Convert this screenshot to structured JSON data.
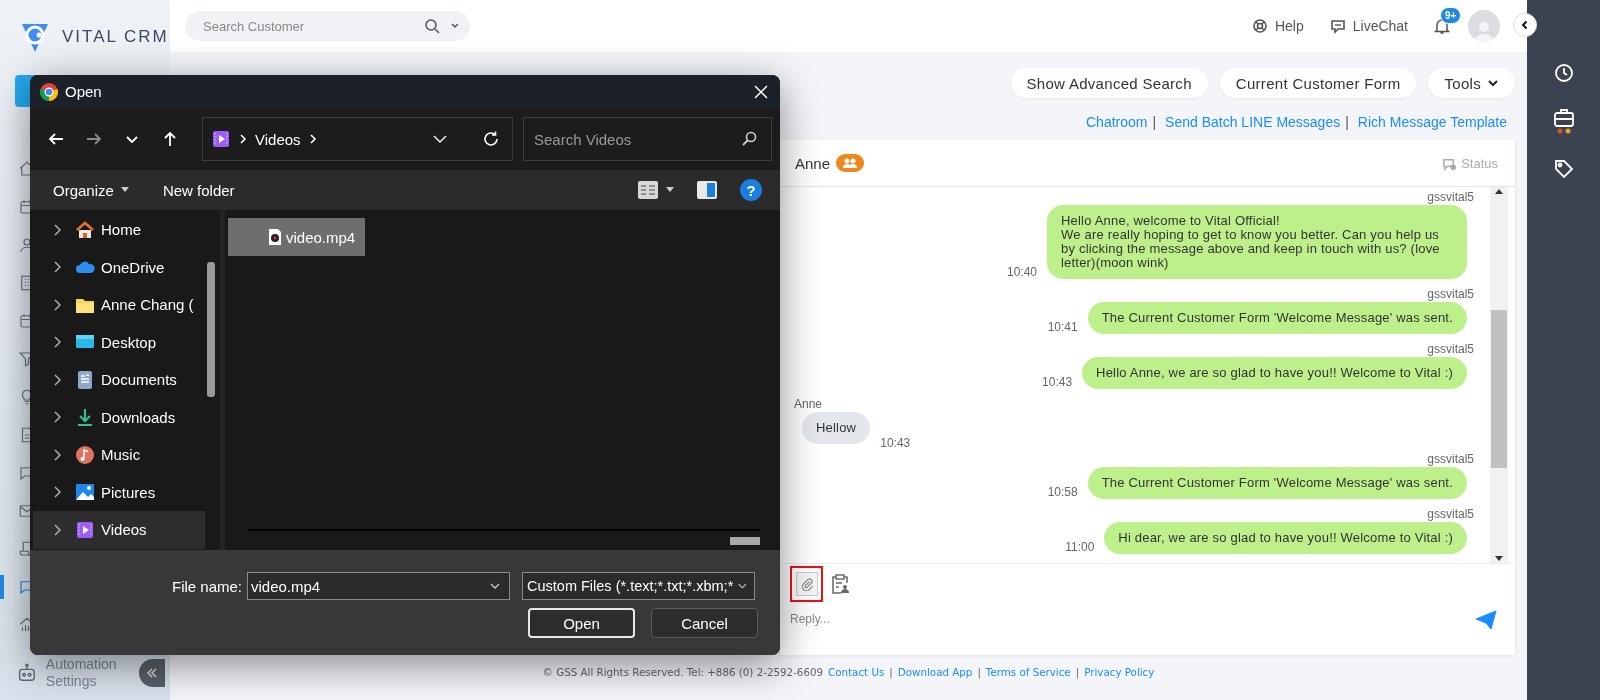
{
  "sidebar": {
    "logo": "VITAL CRM",
    "items": [
      {
        "kind": "home",
        "selected": false
      },
      {
        "kind": "calendar",
        "selected": false
      },
      {
        "kind": "user",
        "selected": false
      },
      {
        "kind": "building",
        "selected": false
      },
      {
        "kind": "calendar",
        "selected": false
      },
      {
        "kind": "filter",
        "selected": false
      },
      {
        "kind": "lightbulb",
        "selected": false
      },
      {
        "kind": "document",
        "selected": false
      },
      {
        "kind": "chat",
        "selected": false
      },
      {
        "kind": "mail",
        "selected": false
      },
      {
        "kind": "scroll",
        "selected": false
      },
      {
        "kind": "chat",
        "selected": true
      },
      {
        "kind": "chart",
        "selected": false
      }
    ],
    "bottom_item": {
      "label": "Automation Settings"
    }
  },
  "topbar": {
    "search": {
      "placeholder": "Search Customer"
    },
    "links": [
      {
        "kind": "help",
        "label": "Help"
      },
      {
        "kind": "livechat",
        "label": "LiveChat"
      }
    ],
    "notification_count": "9+"
  },
  "actions": [
    {
      "label": "Show Advanced Search",
      "menu": false
    },
    {
      "label": "Current Customer Form",
      "menu": false
    },
    {
      "label": "Tools",
      "menu": true
    }
  ],
  "link_bar": [
    {
      "kind": "link",
      "text": "Chatroom"
    },
    {
      "kind": "separator",
      "text": "|"
    },
    {
      "kind": "link",
      "text": "Send Batch LINE Messages"
    },
    {
      "kind": "separator",
      "text": "|"
    },
    {
      "kind": "link",
      "text": "Rich Message Template"
    }
  ],
  "chat": {
    "contact": "Anne",
    "status": "Status",
    "messages": [
      {
        "kind": "outgoing",
        "sender": "gssvital5",
        "text": "Hello Anne, welcome to Vital Official!\nWe are really hoping to get to know you better. Can you help us by clicking the message above and keep in touch with us? (love letter)(moon wink)",
        "time": "10:40"
      },
      {
        "kind": "outgoing",
        "sender": "gssvital5",
        "text": "The Current Customer Form 'Welcome Message' was sent.",
        "time": "10:41"
      },
      {
        "kind": "outgoing",
        "sender": "gssvital5",
        "text": "Hello Anne, we are so glad to have you!! Welcome to Vital :)",
        "time": "10:43"
      },
      {
        "kind": "incoming",
        "sender": "Anne",
        "text": "Hellow",
        "time": "10:43"
      },
      {
        "kind": "outgoing",
        "sender": "gssvital5",
        "text": "The Current Customer Form 'Welcome Message' was sent.",
        "time": "10:58"
      },
      {
        "kind": "outgoing",
        "sender": "gssvital5",
        "text": "Hi dear, we are so glad to have you!! Welcome to Vital :)",
        "time": "11:00"
      }
    ],
    "composer": {
      "placeholder": "Reply...",
      "attach_highlighted": true
    }
  },
  "footer": [
    {
      "kind": "text",
      "text": "© GSS All Rights Reserved. Tel: +886 (0) 2-2592-6609"
    },
    {
      "kind": "link",
      "text": "Contact Us"
    },
    {
      "kind": "separator",
      "text": "|"
    },
    {
      "kind": "link",
      "text": "Download App"
    },
    {
      "kind": "separator",
      "text": "|"
    },
    {
      "kind": "link",
      "text": "Terms of Service"
    },
    {
      "kind": "separator",
      "text": "|"
    },
    {
      "kind": "link",
      "text": "Privacy Policy"
    }
  ],
  "dialog": {
    "title": "Open",
    "address": [
      "Videos"
    ],
    "search": {
      "placeholder": "Search Videos"
    },
    "commands": [
      {
        "label": "Organize",
        "menu": true
      },
      {
        "label": "New folder",
        "menu": false
      }
    ],
    "help": "?",
    "nav_items": [
      {
        "kind": "home",
        "label": "Home",
        "expanded": false,
        "selected": false
      },
      {
        "kind": "cloud",
        "label": "OneDrive",
        "expanded": false,
        "selected": false
      },
      {
        "kind": "folder",
        "label": "Anne Chang (",
        "expanded": false,
        "selected": false
      },
      {
        "kind": "desktop",
        "label": "Desktop",
        "expanded": false,
        "selected": false
      },
      {
        "kind": "documents",
        "label": "Documents",
        "expanded": false,
        "selected": false
      },
      {
        "kind": "downloads",
        "label": "Downloads",
        "expanded": false,
        "selected": false
      },
      {
        "kind": "music",
        "label": "Music",
        "expanded": false,
        "selected": false
      },
      {
        "kind": "pictures",
        "label": "Pictures",
        "expanded": false,
        "selected": false
      },
      {
        "kind": "videos",
        "label": "Videos",
        "expanded": false,
        "selected": true
      }
    ],
    "files": [
      {
        "name": "video.mp4",
        "selected": true
      }
    ],
    "file_name": {
      "label": "File name:",
      "value": "video.mp4"
    },
    "file_type": "Custom Files (*.text;*.txt;*.xbm;*",
    "buttons": [
      {
        "label": "Open",
        "default": true
      },
      {
        "label": "Cancel",
        "default": false
      }
    ]
  }
}
